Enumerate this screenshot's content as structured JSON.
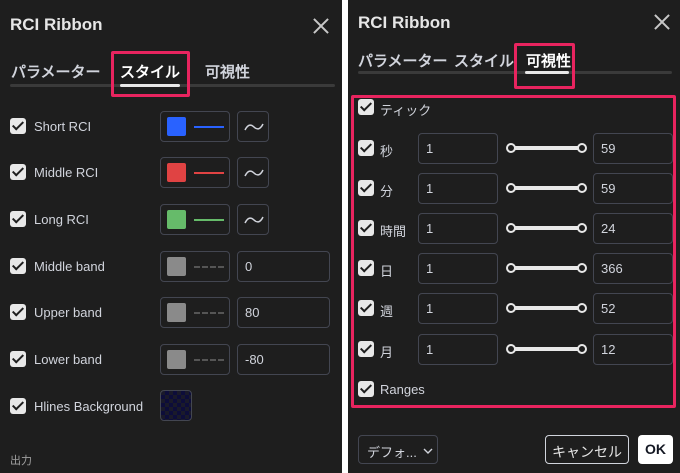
{
  "dialog_title": "RCI Ribbon",
  "tabs": {
    "params": "パラメーター",
    "style": "スタイル",
    "visibility": "可視性"
  },
  "style_rows": [
    {
      "label": "Short RCI",
      "color": "#2962ff",
      "value": ""
    },
    {
      "label": "Middle RCI",
      "color": "#e04343",
      "value": ""
    },
    {
      "label": "Long RCI",
      "color": "#66bb6a",
      "value": ""
    },
    {
      "label": "Middle band",
      "color": "#8a8a8a",
      "value": "0"
    },
    {
      "label": "Upper band",
      "color": "#8a8a8a",
      "value": "80"
    },
    {
      "label": "Lower band",
      "color": "#8a8a8a",
      "value": "-80"
    },
    {
      "label": "Hlines Background",
      "color": "",
      "value": ""
    }
  ],
  "output_section": "出力",
  "visibility": {
    "tick_label": "ティック",
    "rows": [
      {
        "label": "秒",
        "min": "1",
        "max": "59",
        "range_fraction": 1.0
      },
      {
        "label": "分",
        "min": "1",
        "max": "59",
        "range_fraction": 1.0
      },
      {
        "label": "時間",
        "min": "1",
        "max": "24",
        "range_fraction": 1.0
      },
      {
        "label": "日",
        "min": "1",
        "max": "366",
        "range_fraction": 1.0
      },
      {
        "label": "週",
        "min": "1",
        "max": "52",
        "range_fraction": 1.0
      },
      {
        "label": "月",
        "min": "1",
        "max": "12",
        "range_fraction": 1.0
      }
    ],
    "ranges_label": "Ranges"
  },
  "footer": {
    "defaults": "デフォ...",
    "cancel": "キャンセル",
    "ok": "OK"
  },
  "colors": {
    "highlight": "#e8245f",
    "background": "#1e1e1e"
  }
}
